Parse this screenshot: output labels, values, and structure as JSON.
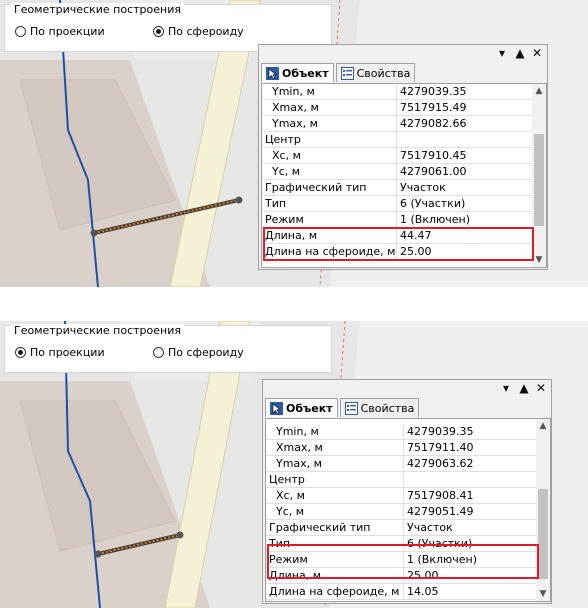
{
  "panels": [
    {
      "group_title": "Геометрические построения",
      "options": [
        {
          "label": "По проекции",
          "checked": false
        },
        {
          "label": "По сфероиду",
          "checked": true
        }
      ],
      "tabs": [
        {
          "label": "Объект",
          "icon": "cursor-icon",
          "active": true
        },
        {
          "label": "Свойства",
          "icon": "properties-icon",
          "active": false
        }
      ],
      "rows": [
        {
          "key": "Ymin, м",
          "value": "4279039.35",
          "indent": true
        },
        {
          "key": "Xmax, м",
          "value": "7517915.49",
          "indent": true
        },
        {
          "key": "Ymax, м",
          "value": "4279082.66",
          "indent": true
        },
        {
          "key": "Центр",
          "value": "",
          "indent": false
        },
        {
          "key": "Xc, м",
          "value": "7517910.45",
          "indent": true
        },
        {
          "key": "Yc, м",
          "value": "4279061.00",
          "indent": true
        },
        {
          "key": "Графический тип",
          "value": "Участок",
          "indent": false
        },
        {
          "key": "Тип",
          "value": "6 (Участки)",
          "indent": false
        },
        {
          "key": "Режим",
          "value": "1 (Включен)",
          "indent": false
        },
        {
          "key": "Длина, м",
          "value": "44.47",
          "indent": false
        },
        {
          "key": "Длина на сфероиде, м",
          "value": "25.00",
          "indent": false
        }
      ]
    },
    {
      "group_title": "Геометрические построения",
      "options": [
        {
          "label": "По проекции",
          "checked": true
        },
        {
          "label": "По сфероиду",
          "checked": false
        }
      ],
      "tabs": [
        {
          "label": "Объект",
          "icon": "cursor-icon",
          "active": true
        },
        {
          "label": "Свойства",
          "icon": "properties-icon",
          "active": false
        }
      ],
      "rows": [
        {
          "key": "Ymin, м",
          "value": "4279039.35",
          "indent": true
        },
        {
          "key": "Xmax, м",
          "value": "7517911.40",
          "indent": true
        },
        {
          "key": "Ymax, м",
          "value": "4279063.62",
          "indent": true
        },
        {
          "key": "Центр",
          "value": "",
          "indent": false
        },
        {
          "key": "Xc, м",
          "value": "7517908.41",
          "indent": true
        },
        {
          "key": "Yc, м",
          "value": "4279051.49",
          "indent": true
        },
        {
          "key": "Графический тип",
          "value": "Участок",
          "indent": false
        },
        {
          "key": "Тип",
          "value": "6 (Участки)",
          "indent": false
        },
        {
          "key": "Режим",
          "value": "1 (Включен)",
          "indent": false
        },
        {
          "key": "Длина, м",
          "value": "25.00",
          "indent": false
        },
        {
          "key": "Длина на сфероиде, м",
          "value": "14.05",
          "indent": false
        }
      ]
    }
  ],
  "colors": {
    "highlight": "#e01b24",
    "map_building": "#d8cfc8",
    "map_road": "#e8e8e8",
    "map_line_blue": "#1f4fa8",
    "measure_line": "#e07a1a"
  }
}
